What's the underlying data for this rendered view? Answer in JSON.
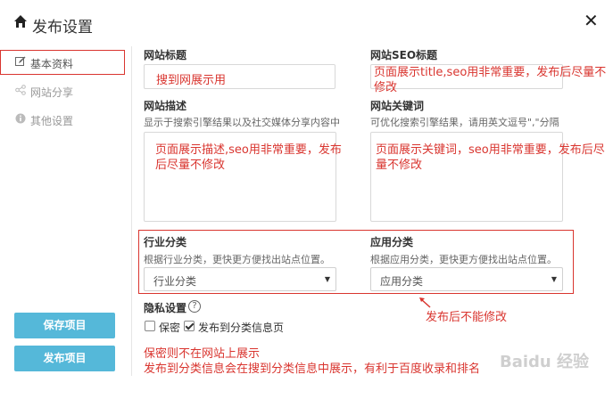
{
  "dialog": {
    "title": "发布设置"
  },
  "sidebar": {
    "items": [
      {
        "label": "基本资料",
        "icon": "edit-icon",
        "active": true
      },
      {
        "label": "网站分享",
        "icon": "share-icon",
        "active": false
      },
      {
        "label": "其他设置",
        "icon": "info-icon",
        "active": false
      }
    ],
    "save_label": "保存项目",
    "publish_label": "发布项目"
  },
  "form": {
    "site_title": {
      "label": "网站标题",
      "value": "搜到网展示用"
    },
    "seo_title": {
      "label": "网站SEO标题",
      "value": "页面展示title,seo用非常重要，发布后尽量不修改"
    },
    "description": {
      "label": "网站描述",
      "hint": "显示于搜索引擎结果以及社交媒体分享内容中",
      "value": "页面展示描述,seo用非常重要，发布后尽量不修改"
    },
    "keywords": {
      "label": "网站关键词",
      "hint": "可优化搜索引擎结果，请用英文逗号\",\"分隔",
      "value": "页面展示关键词，seo用非常重要，发布后尽量不修改"
    },
    "industry": {
      "label": "行业分类",
      "hint": "根据行业分类，更快更方便找出站点位置。",
      "value": "行业分类"
    },
    "application": {
      "label": "应用分类",
      "hint": "根据应用分类，更快更方便找出站点位置。",
      "value": "应用分类"
    },
    "privacy": {
      "label": "隐私设置",
      "secret_label": "保密",
      "secret_checked": false,
      "publish_category_label": "发布到分类信息页",
      "publish_category_checked": true
    }
  },
  "annotations": {
    "no_modify": "发布后不能修改",
    "secret_note": "保密则不在网站上展示",
    "category_note": "发布到分类信息会在搜到分类信息中展示，有利于百度收录和排名"
  },
  "watermark": "Baidu 经验",
  "colors": {
    "accent_button": "#55b8d9",
    "annotation_red": "#d9352f"
  }
}
